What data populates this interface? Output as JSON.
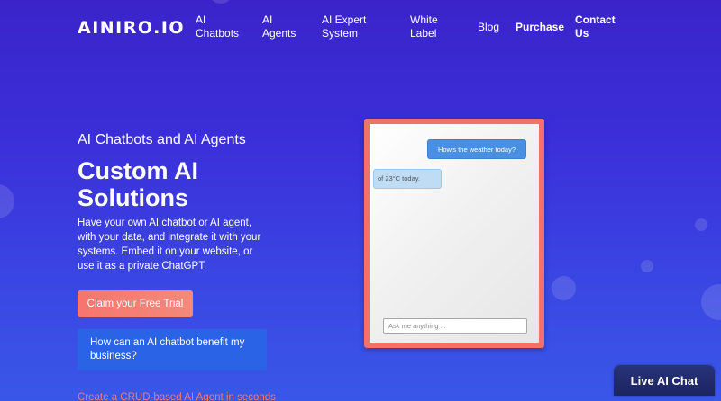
{
  "header": {
    "logo": "AINIRO.IO",
    "nav": [
      {
        "label": "AI Chatbots"
      },
      {
        "label": "AI Agents"
      },
      {
        "label": "AI Expert System"
      },
      {
        "label": "White Label"
      },
      {
        "label": "Blog"
      },
      {
        "label": "Purchase"
      },
      {
        "label": "Contact Us"
      }
    ]
  },
  "hero": {
    "subtitle": "AI Chatbots and AI Agents",
    "title": "Custom AI Solutions",
    "description": "Have your own AI chatbot or AI agent, with your data, and integrate it with your systems. Embed it on your website, or use it as a private ChatGPT.",
    "cta_label": "Claim your Free Trial",
    "faq_label": "How can an AI chatbot benefit my business?",
    "crud_link": "Create a CRUD-based AI Agent in seconds"
  },
  "chat": {
    "user_message": "How's the weather today?",
    "bot_message": "of 23°C today.",
    "input_placeholder": "Ask me anything ..."
  },
  "live_chat": {
    "label": "Live AI Chat"
  },
  "colors": {
    "background_top": "#3a24c9",
    "background_bottom": "#3957e8",
    "cta": "#f6756e",
    "faq_button": "#2a63e6",
    "chat_frame": "#f3716a",
    "user_bubble": "#4a90e2",
    "bot_bubble": "#bfdcf5",
    "live_chat": "#1c2560"
  }
}
